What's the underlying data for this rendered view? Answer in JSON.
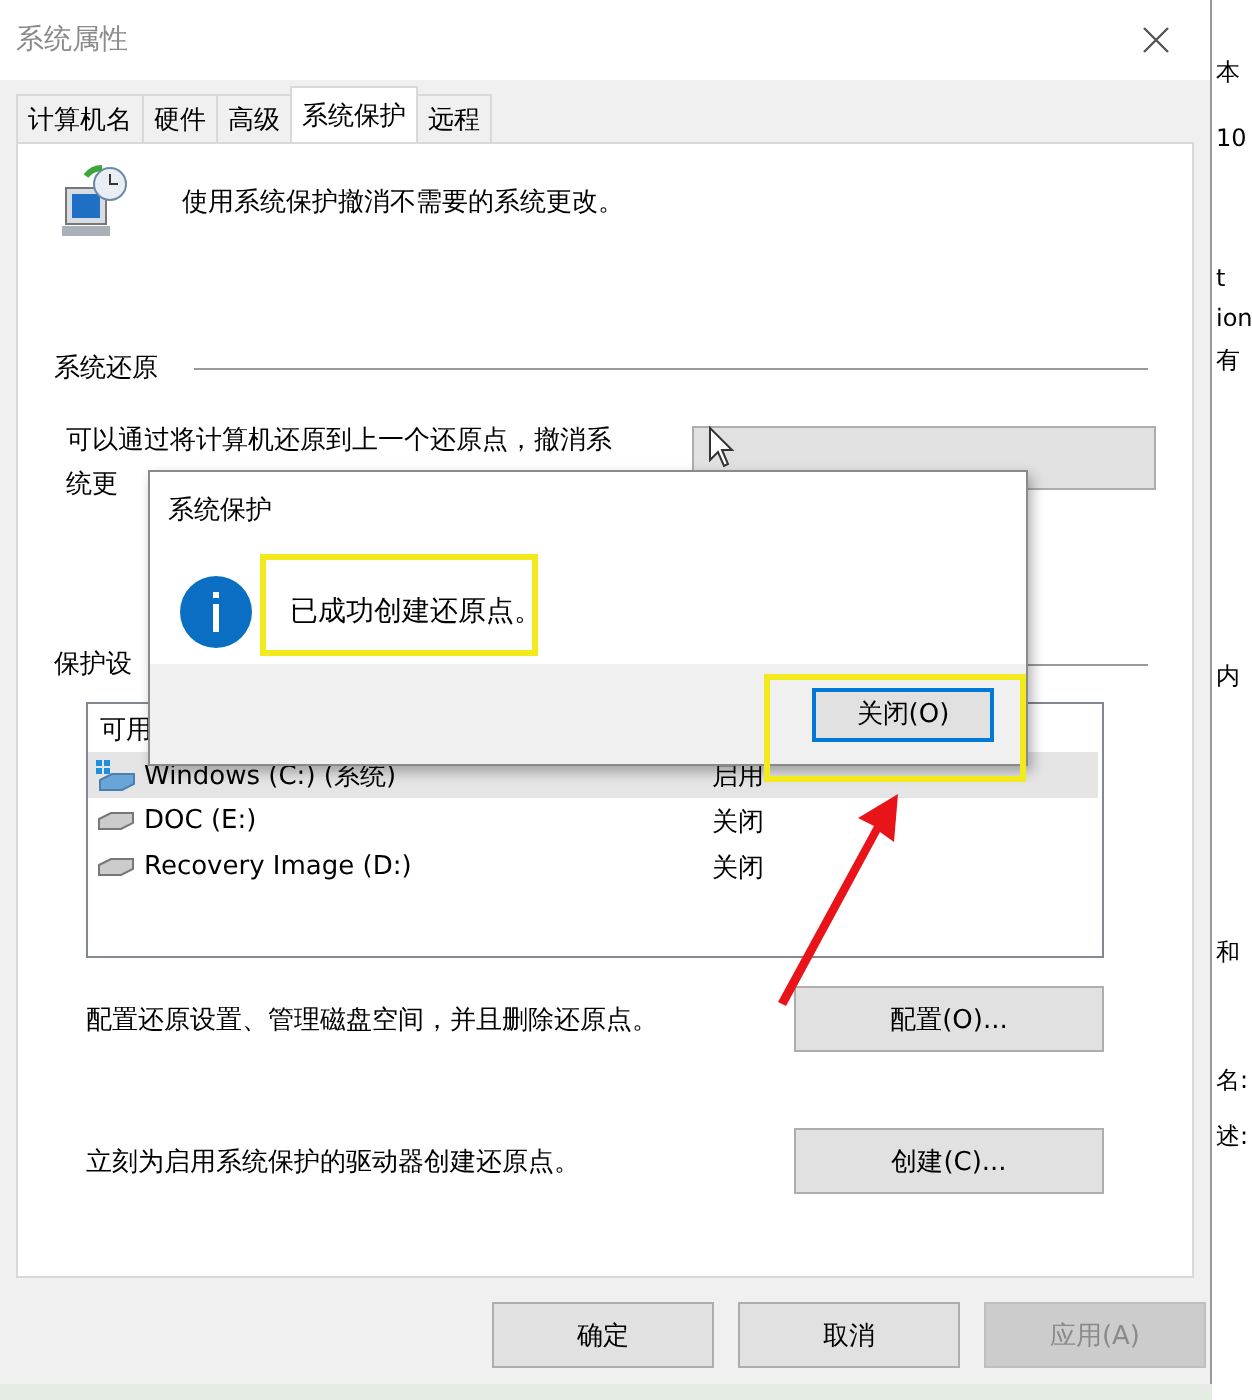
{
  "window": {
    "title": "系统属性",
    "active": false
  },
  "tabs": [
    {
      "label": "计算机名",
      "selected": false
    },
    {
      "label": "硬件",
      "selected": false
    },
    {
      "label": "高级",
      "selected": false
    },
    {
      "label": "系统保护",
      "selected": true
    },
    {
      "label": "远程",
      "selected": false
    }
  ],
  "intro": "使用系统保护撤消不需要的系统更改。",
  "restore_section": {
    "heading": "系统还原",
    "description_lines": [
      "可以通过将计算机还原到上一个还原点，撤消系",
      "统更"
    ]
  },
  "protection_section": {
    "heading": "保护设",
    "drives_table": {
      "columns": [
        "可用"
      ],
      "rows": [
        {
          "name": "Windows (C:) (系统)",
          "protection": "启用",
          "kind": "system",
          "selected": true
        },
        {
          "name": "DOC (E:)",
          "protection": "关闭",
          "kind": "disk",
          "selected": false
        },
        {
          "name": "Recovery Image (D:)",
          "protection": "关闭",
          "kind": "disk",
          "selected": false
        }
      ]
    }
  },
  "configure": {
    "text": "配置还原设置、管理磁盘空间，并且删除还原点。",
    "button": "配置(O)..."
  },
  "create": {
    "text": "立刻为启用系统保护的驱动器创建还原点。",
    "button": "创建(C)..."
  },
  "footer_buttons": [
    {
      "label": "确定",
      "disabled": false
    },
    {
      "label": "取消",
      "disabled": false
    },
    {
      "label": "应用(A)",
      "disabled": true
    }
  ],
  "message_dialog": {
    "title": "系统保护",
    "message": "已成功创建还原点。",
    "button": "关闭(O)"
  },
  "background_fragments": [
    "本",
    "10",
    "t",
    "ion",
    "有",
    "内",
    "和",
    "名:",
    "述:"
  ]
}
